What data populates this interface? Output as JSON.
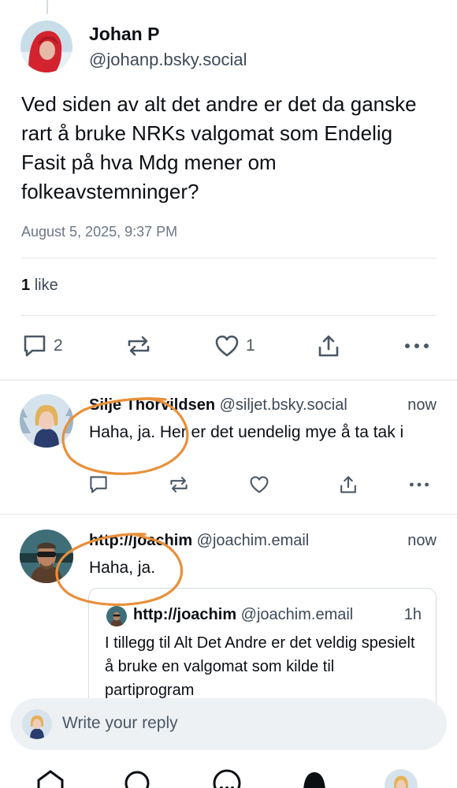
{
  "main_post": {
    "author_name": "Johan P",
    "author_handle": "@johanp.bsky.social",
    "text": "Ved siden av alt det andre er det da ganske rart å bruke NRKs valgomat som Endelig Fasit på hva Mdg mener om folkeavstemninger?",
    "date": "August 5, 2025, 9:37 PM",
    "likes_count": "1",
    "likes_label": "like",
    "reply_count": "2",
    "like_count": "1"
  },
  "replies": [
    {
      "author_name": "Silje Thorvildsen",
      "author_handle": "@siljet.bsky.social",
      "time": "now",
      "text": "Haha, ja. Her er det uendelig mye å ta tak i"
    },
    {
      "author_name": "http://joachim",
      "author_handle": "@joachim.email",
      "time": "now",
      "text": "Haha, ja.",
      "quote": {
        "author_name": "http://joachim",
        "author_handle": "@joachim.email",
        "time": "1h",
        "text": "I tillegg til Alt Det Andre er det veldig spesielt å bruke en valgomat som kilde til partiprogram"
      }
    }
  ],
  "composer": {
    "placeholder": "Write your reply"
  },
  "colors": {
    "annotation": "#e8903a",
    "icon": "#4a5866"
  }
}
